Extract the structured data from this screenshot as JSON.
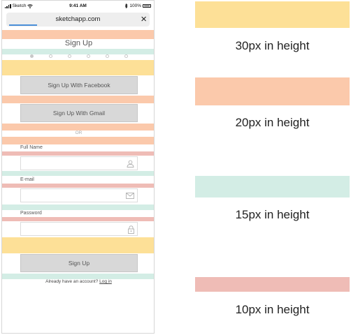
{
  "status_bar": {
    "carrier": "Sketch",
    "time": "9:41 AM",
    "battery": "100%"
  },
  "browser": {
    "url": "sketchapp.com",
    "close_glyph": "×"
  },
  "page": {
    "title": "Sign Up",
    "buttons": {
      "facebook": "Sign Up With Facebook",
      "gmail": "Sign Up With Gmail",
      "submit": "Sign Up"
    },
    "divider": "OR",
    "fields": {
      "full_name": "Full Name",
      "email": "E-mail",
      "password": "Password"
    },
    "footer": {
      "prompt": "Already have an account?",
      "login_link": "Log in"
    }
  },
  "legend": [
    {
      "label": "30px in height",
      "color": "#fde097"
    },
    {
      "label": "20px in height",
      "color": "#fbc9ab"
    },
    {
      "label": "15px in height",
      "color": "#d3ede5"
    },
    {
      "label": "10px in height",
      "color": "#efbcb6"
    }
  ],
  "icons": [
    "wifi-icon",
    "bluetooth-icon",
    "battery-icon",
    "close-icon",
    "user-icon",
    "mail-icon",
    "lock-icon"
  ]
}
